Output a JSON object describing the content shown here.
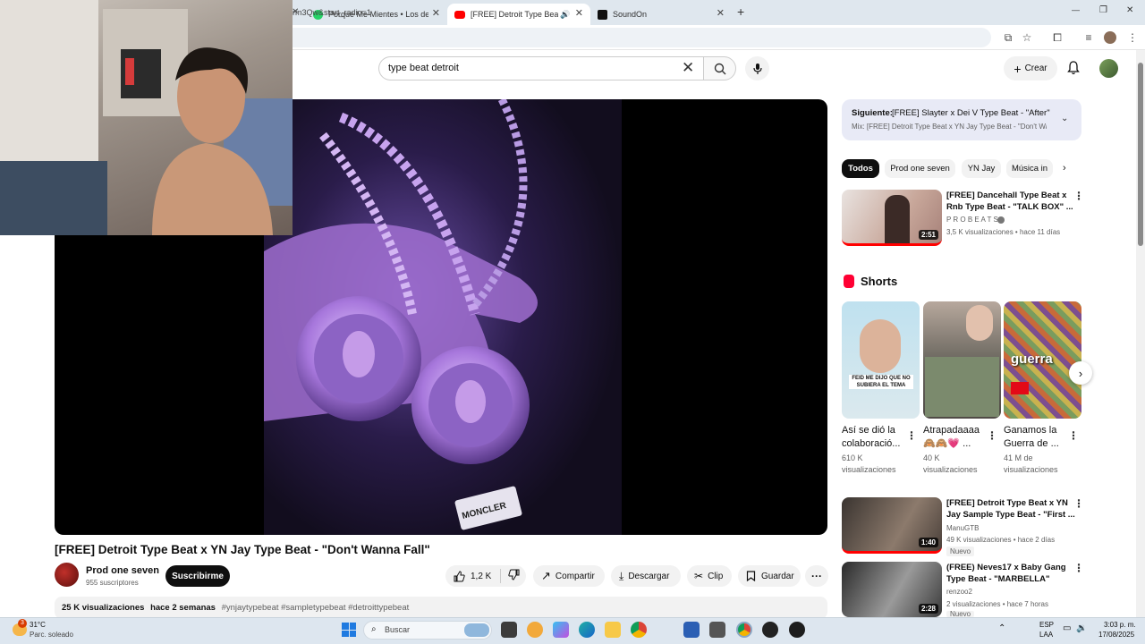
{
  "browser": {
    "tabs": [
      {
        "label": "Porque Me Mientes • Los del Tu"
      },
      {
        "label": "[FREE] Detroit Type Beat x Y"
      },
      {
        "label": "SoundOn"
      }
    ],
    "new_tab": "+",
    "url": "rm3Qw&start_radio=1",
    "window_controls": {
      "minimize": "—",
      "restore": "❐",
      "close": "✕"
    }
  },
  "header": {
    "search_value": "type beat detroit",
    "create_label": "Crear"
  },
  "video": {
    "title": "[FREE] Detroit Type Beat x YN Jay Type Beat - \"Don't Wanna Fall\"",
    "channel_name": "Prod one seven",
    "subscribers": "955 suscriptores",
    "subscribe_label": "Suscribirme",
    "likes": "1,2 K",
    "share_label": "Compartir",
    "download_label": "Descargar",
    "clip_label": "Clip",
    "save_label": "Guardar",
    "description": {
      "views": "25 K visualizaciones",
      "date": "hace 2 semanas",
      "tags": "#ynjaytypebeat #sampletypebeat #detroittypebeat"
    },
    "pendant_text": "MONCLER"
  },
  "sidebar": {
    "next_label": "Siguiente:",
    "next_title": "[FREE] Slayter x Dei V Type Beat - \"After\" |...",
    "mix_title": "Mix: [FREE] Detroit Type Beat x YN Jay Type Beat - \"Don't Wa...",
    "chips": [
      "Todos",
      "Prod one seven",
      "YN Jay",
      "Música in"
    ],
    "shorts_heading": "Shorts",
    "videos": [
      {
        "title1": "[FREE] Dancehall Type Beat x",
        "title2": "Rnb Type Beat - \"TALK BOX\" ...",
        "channel": "P R O B E A T S",
        "meta": "3,5 K visualizaciones • hace 11 días",
        "duration": "2:51"
      },
      {
        "title1": "[FREE] Detroit Type Beat x YN",
        "title2": "Jay Sample Type Beat - \"First ...",
        "channel": "ManuGTB",
        "meta": "49 K visualizaciones • hace 2 días",
        "badge": "Nuevo",
        "duration": "1:40"
      },
      {
        "title1": "(FREE) Neves17 x Baby Gang",
        "title2": "Type Beat - \"MARBELLA\"",
        "channel": "renzoo2",
        "meta": "2 visualizaciones • hace 7 horas",
        "badge": "Nuevo",
        "duration": "2:28"
      }
    ],
    "shorts": [
      {
        "title1": "Así se dió la",
        "title2": "colaboració...",
        "views1": "610 K",
        "views2": "visualizaciones",
        "caption": "FEID ME DIJO QUE NO SUBIERA EL TEMA"
      },
      {
        "title1": "Atrapadaaaa",
        "title2": "🙈🙈💗 ...",
        "views1": "40 K",
        "views2": "visualizaciones"
      },
      {
        "title1": "Ganamos la",
        "title2": "Guerra de ...",
        "views1": "41 M de",
        "views2": "visualizaciones",
        "caption": "guerra"
      }
    ]
  },
  "taskbar": {
    "weather_temp": "31°C",
    "weather_desc": "Parc. soleado",
    "weather_badge": "3",
    "search_label": "Buscar",
    "lang1": "ESP",
    "lang2": "LAA",
    "time": "3:03 p. m.",
    "date": "17/08/2025"
  },
  "colors": {
    "youtube_red": "#ff0000",
    "shorts_red": "#ff0033",
    "taskbar": "#dde6ef",
    "purple_glow": "#8b5cf6"
  }
}
